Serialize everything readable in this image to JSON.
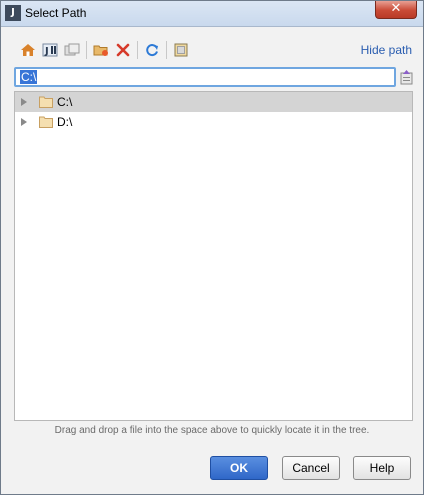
{
  "window": {
    "title": "Select Path",
    "close_glyph": "✕",
    "app_icon_text": "J"
  },
  "toolbar": {
    "icons": [
      "home-icon",
      "project-icon",
      "module-icon",
      "new-folder-icon",
      "delete-icon",
      "refresh-icon",
      "show-hidden-icon"
    ],
    "hide_path_label": "Hide path"
  },
  "path": {
    "value": "C:\\"
  },
  "tree": {
    "items": [
      {
        "label": "C:\\",
        "selected": true
      },
      {
        "label": "D:\\",
        "selected": false
      }
    ]
  },
  "hint": "Drag and drop a file into the space above to quickly locate it in the tree.",
  "buttons": {
    "ok": "OK",
    "cancel": "Cancel",
    "help": "Help"
  },
  "colors": {
    "accent": "#3875d7",
    "link": "#2a5db0",
    "folder": "#c8a062",
    "delete": "#d63a2a",
    "refresh": "#2d7ad6"
  }
}
